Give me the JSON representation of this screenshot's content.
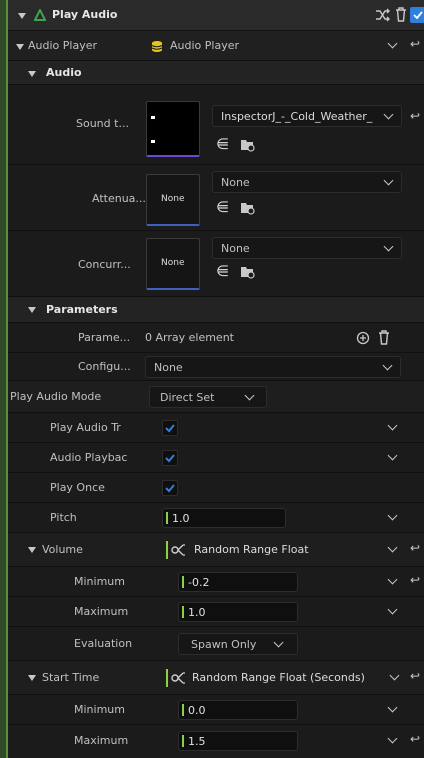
{
  "header": {
    "title": "Play Audio"
  },
  "audio_player": {
    "label": "Audio Player",
    "value": "Audio Player"
  },
  "audio_section": {
    "title": "Audio"
  },
  "sound": {
    "label": "Sound t...",
    "asset": "InspectorJ_-_Cold_Weather_"
  },
  "attenuation": {
    "label": "Attenua...",
    "thumb": "None",
    "asset": "None"
  },
  "concurrency": {
    "label": "Concurr...",
    "thumb": "None",
    "asset": "None"
  },
  "parameters_section": {
    "title": "Parameters"
  },
  "parameters": {
    "label": "Parame...",
    "value": "0 Array element"
  },
  "configuration": {
    "label": "Configu...",
    "value": "None"
  },
  "play_audio_mode": {
    "label": "Play Audio Mode",
    "value": "Direct Set"
  },
  "play_audio_trigger": {
    "label": "Play Audio Tr",
    "checked": true
  },
  "audio_playback": {
    "label": "Audio Playbac",
    "checked": true
  },
  "play_once": {
    "label": "Play Once",
    "checked": true
  },
  "pitch": {
    "label": "Pitch",
    "value": "1.0"
  },
  "volume": {
    "label": "Volume",
    "value": "Random Range Float",
    "minimum": {
      "label": "Minimum",
      "value": "-0.2"
    },
    "maximum": {
      "label": "Maximum",
      "value": "1.0"
    },
    "evaluation": {
      "label": "Evaluation",
      "value": "Spawn Only"
    }
  },
  "start_time": {
    "label": "Start Time",
    "value": "Random Range Float (Seconds)",
    "minimum": {
      "label": "Minimum",
      "value": "0.0"
    },
    "maximum": {
      "label": "Maximum",
      "value": "1.5"
    }
  },
  "colors": {
    "accent_check": "#2f7fdc",
    "number_bar": "#8bd148",
    "module_icon": "#3fa34d",
    "asset_icon": "#e8c51a"
  }
}
